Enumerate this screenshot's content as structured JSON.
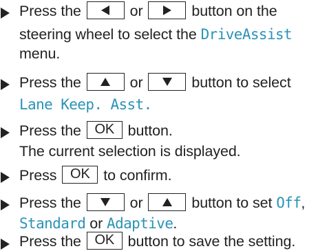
{
  "colors": {
    "text": "#222222",
    "menu_highlight": "#2a93b5"
  },
  "icons": {
    "bullet": "right-pointing-triangle",
    "left_key": "left-arrow-key",
    "right_key": "right-arrow-key",
    "up_key": "up-arrow-key",
    "down_key": "down-arrow-key"
  },
  "steps": [
    {
      "l1_a": "Press the",
      "l1_or": "or",
      "l1_b": "button on the",
      "l2_a": "steering wheel to select the",
      "l2_menu": "DriveAssist",
      "l3": "menu."
    },
    {
      "l1_a": "Press the",
      "l1_or": "or",
      "l1_b": "button to select",
      "l2_menu": "Lane Keep. Asst."
    },
    {
      "l1_a": "Press the",
      "l1_key": "OK",
      "l1_b": "button.",
      "l2": "The current selection is displayed."
    },
    {
      "l1_a": "Press",
      "l1_key": "OK",
      "l1_b": "to confirm."
    },
    {
      "l1_a": "Press the",
      "l1_or": "or",
      "l1_b": "button to set",
      "l1_opt": "Off",
      "l1_comma": ",",
      "l2_opt1": "Standard",
      "l2_or": "or",
      "l2_opt2": "Adaptive",
      "l2_end": "."
    },
    {
      "l1_a": "Press the",
      "l1_key": "OK",
      "l1_b": "button to save the setting."
    }
  ]
}
